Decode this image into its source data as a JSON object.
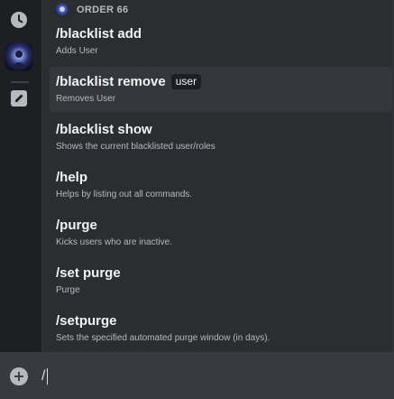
{
  "rail": {
    "icons": [
      "clock-icon",
      "server-avatar",
      "pencil-icon"
    ]
  },
  "autocomplete": {
    "bot_name": "ORDER 66",
    "commands": [
      {
        "name": "/blacklist add",
        "option": "",
        "description": "Adds User"
      },
      {
        "name": "/blacklist remove",
        "option": "user",
        "description": "Removes User"
      },
      {
        "name": "/blacklist show",
        "option": "",
        "description": "Shows the current blacklisted user/roles"
      },
      {
        "name": "/help",
        "option": "",
        "description": "Helps by listing out all commands."
      },
      {
        "name": "/purge",
        "option": "",
        "description": "Kicks users who are inactive."
      },
      {
        "name": "/set purge",
        "option": "",
        "description": "Purge"
      },
      {
        "name": "/setpurge",
        "option": "",
        "description": "Sets the specified automated purge window (in days)."
      }
    ],
    "selected_index": 1
  },
  "composer": {
    "value": "/",
    "add_icon": "plus-circle-icon"
  },
  "colors": {
    "rail_bg": "#1e1f22",
    "panel_bg": "#2b2d31",
    "selected_bg": "#36373d",
    "composer_bg": "#383a40"
  }
}
